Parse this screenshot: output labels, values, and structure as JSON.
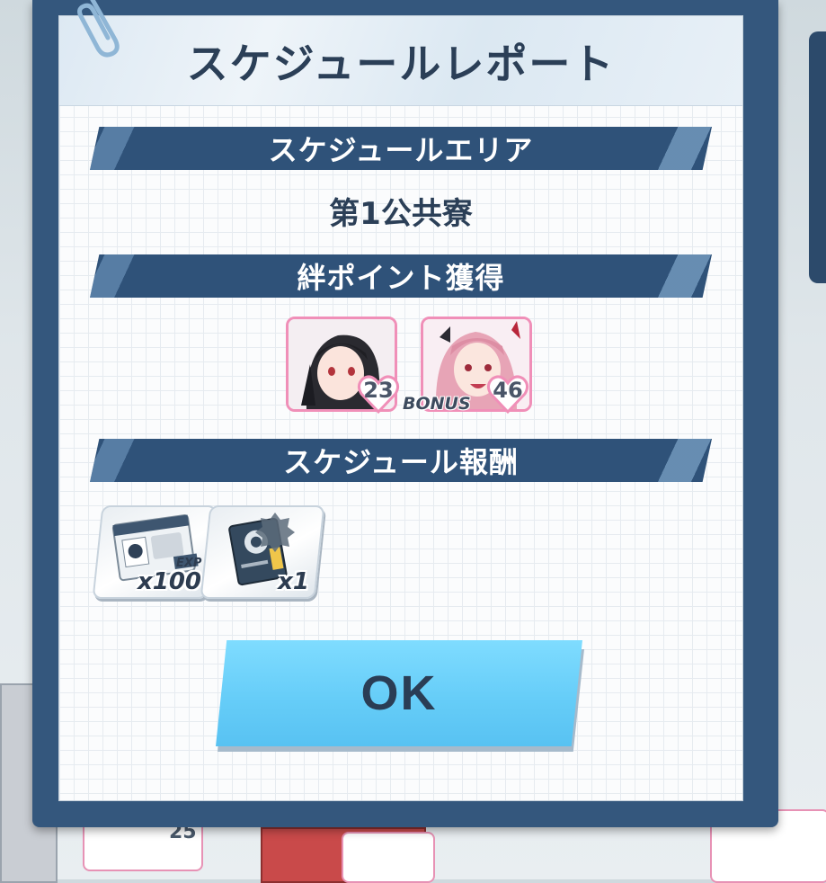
{
  "dialog": {
    "title": "スケジュールレポート",
    "ok_label": "OK"
  },
  "schedule_area": {
    "header": "スケジュールエリア",
    "value": "第1公共寮"
  },
  "bond_points": {
    "header": "絆ポイント獲得",
    "characters": [
      {
        "bond_level": "23",
        "bonus": false
      },
      {
        "bond_level": "46",
        "bonus": true,
        "bonus_label": "BONUS"
      }
    ]
  },
  "rewards": {
    "header": "スケジュール報酬",
    "items": [
      {
        "icon": "location-pass-exp-icon",
        "tag": "EXP",
        "count": "x100"
      },
      {
        "icon": "redwinter-gear-manual-icon",
        "count": "x1"
      }
    ]
  },
  "background": {
    "card_numbers": [
      "25"
    ]
  },
  "colors": {
    "frame": "#34577d",
    "section_bar": "#2f5279",
    "ok_button": "#66cdf8",
    "heart": "#f08fb8"
  }
}
